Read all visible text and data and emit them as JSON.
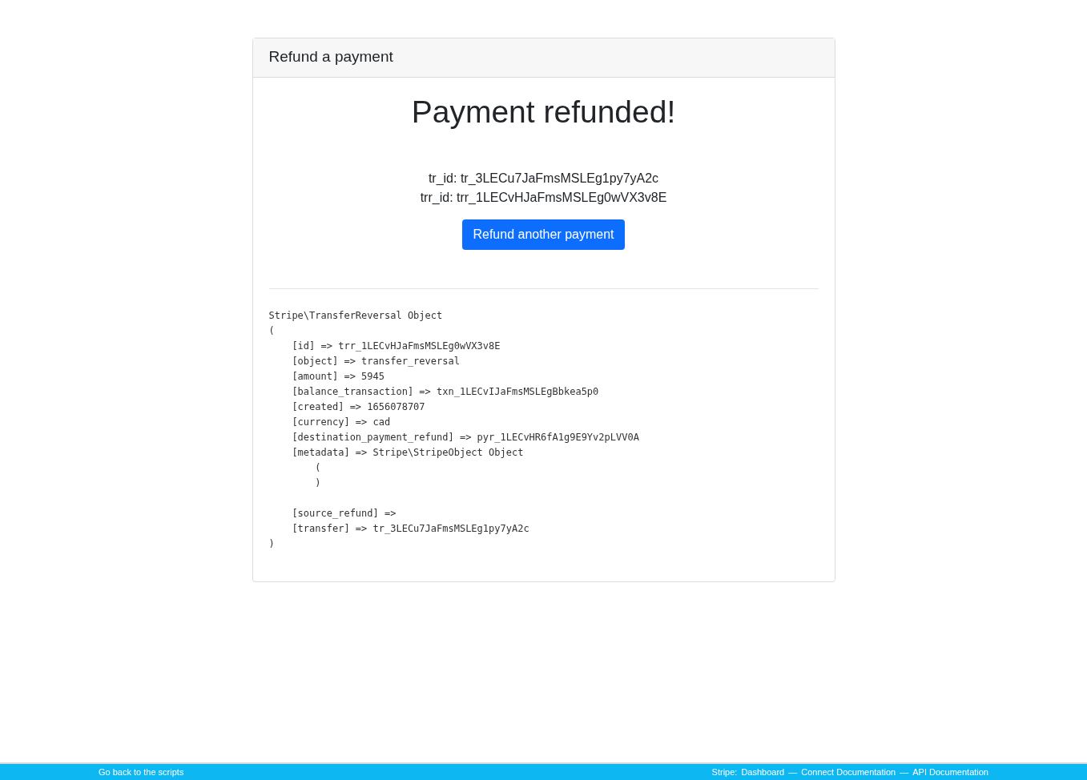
{
  "card": {
    "header": "Refund a payment",
    "heading": "Payment refunded!",
    "ids": [
      "tr_id: tr_3LECu7JaFmsMSLEg1py7yA2c",
      "trr_id: trr_1LECvHJaFmsMSLEg0wVX3v8E"
    ],
    "button": "Refund another payment",
    "dump": "Stripe\\TransferReversal Object\n(\n    [id] => trr_1LECvHJaFmsMSLEg0wVX3v8E\n    [object] => transfer_reversal\n    [amount] => 5945\n    [balance_transaction] => txn_1LECvIJaFmsMSLEgBbkea5p0\n    [created] => 1656078707\n    [currency] => cad\n    [destination_payment_refund] => pyr_1LECvHR6fA1g9E9Yv2pLVV0A\n    [metadata] => Stripe\\StripeObject Object\n        (\n        )\n\n    [source_refund] => \n    [transfer] => tr_3LECu7JaFmsMSLEg1py7yA2c\n)"
  },
  "footer": {
    "left": "Go back to the scripts",
    "right": [
      {
        "kind": "label",
        "text": "Stripe:"
      },
      {
        "kind": "link",
        "text": "Dashboard"
      },
      {
        "kind": "separator",
        "text": "—"
      },
      {
        "kind": "link",
        "text": "Connect Documentation"
      },
      {
        "kind": "separator",
        "text": "—"
      },
      {
        "kind": "link",
        "text": "API Documentation"
      }
    ]
  }
}
